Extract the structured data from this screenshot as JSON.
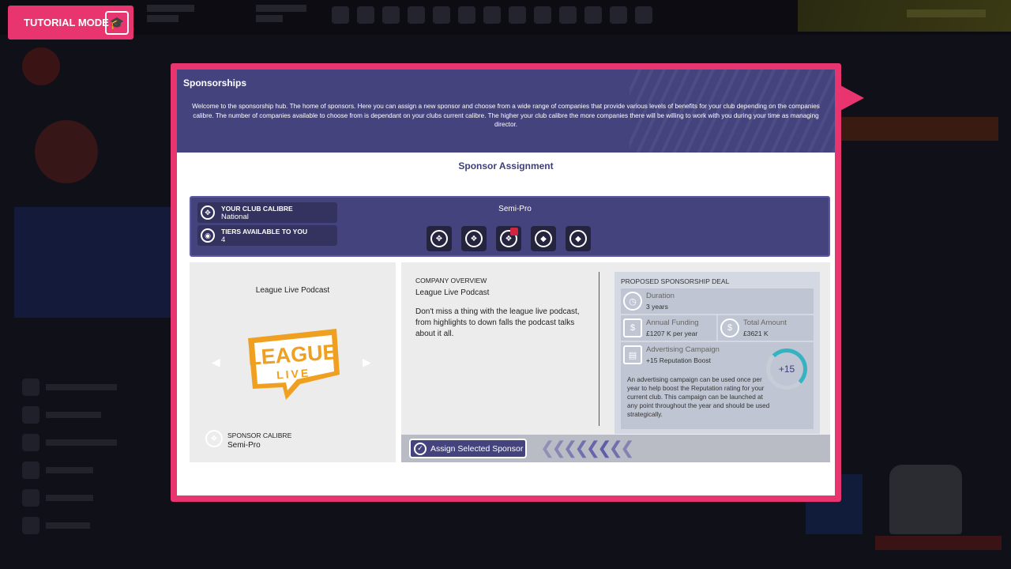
{
  "tutorial": {
    "label": "TUTORIAL MODE"
  },
  "modal": {
    "title": "Sponsorships",
    "description": "Welcome to the sponsorship hub. The home of sponsors. Here you can assign a new sponsor and choose from a wide range of companies that provide various levels of benefits for your club depending on the companies calibre. The number of companies available to choose from is dependant on your clubs current calibre. The higher your club calibre the more companies there will be willing to work with you during your time as managing director.",
    "section_title": "Sponsor Assignment",
    "club_calibre": {
      "label": "YOUR CLUB CALIBRE",
      "value": "National"
    },
    "tiers_available": {
      "label": "TIERS AVAILABLE TO YOU",
      "value": "4"
    },
    "selected_tier_name": "Semi-Pro",
    "tier_icons": [
      "tier-1-icon",
      "tier-2-icon",
      "tier-3-icon",
      "tier-4-icon",
      "tier-5-icon"
    ],
    "selected_tier_index": 2,
    "sponsor": {
      "name": "League Live Podcast",
      "logo_line1": "LEAGUE",
      "logo_line2": "LIVE",
      "calibre_label": "SPONSOR CALIBRE",
      "calibre_value": "Semi-Pro"
    },
    "overview": {
      "heading": "COMPANY OVERVIEW",
      "company": "League Live Podcast",
      "description": "Don't miss a thing with the league live podcast, from highlights to down falls the podcast talks about it all."
    },
    "deal": {
      "heading": "PROPOSED SPONSORSHIP DEAL",
      "duration_label": "Duration",
      "duration_value": "3 years",
      "funding_label": "Annual Funding",
      "funding_value": "£1207 K per year",
      "total_label": "Total Amount",
      "total_value": "£3621 K",
      "campaign_label": "Advertising Campaign",
      "campaign_value": "+15 Reputation Boost",
      "campaign_desc": "An advertising campaign can be used once per year to help boost the Reputation rating for your current club. This campaign can be launched at any point throughout the year and should be used strategically.",
      "boost": "+15"
    },
    "assign_button": "Assign Selected Sponsor"
  },
  "colors": {
    "accent": "#e8346f",
    "purple": "#45437e",
    "teal": "#36b3c1",
    "logo_orange": "#f0a020"
  }
}
